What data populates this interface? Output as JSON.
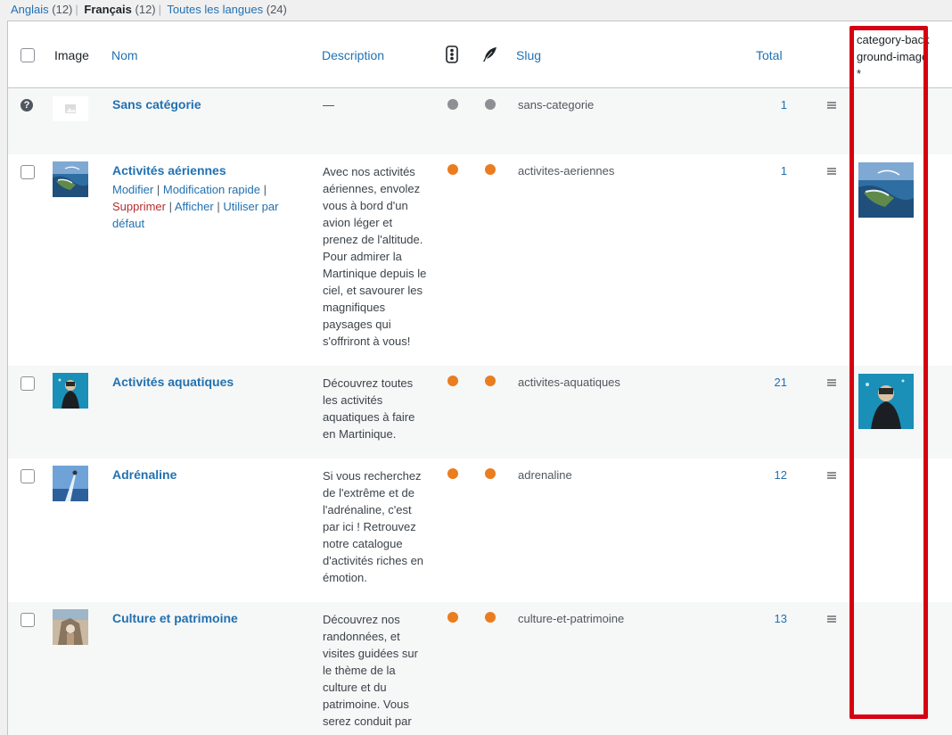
{
  "languages": [
    {
      "label": "Anglais",
      "count": "(12)",
      "current": false
    },
    {
      "label": "Français",
      "count": "(12)",
      "current": true
    },
    {
      "label": "Toutes les langues",
      "count": "(24)",
      "current": false
    }
  ],
  "header": {
    "image": "Image",
    "name": "Nom",
    "description": "Description",
    "slug": "Slug",
    "total": "Total",
    "bg_col": "category-background-image*"
  },
  "icons": {
    "col_translation": "traffic-light-icon",
    "col_quill": "feather-icon",
    "help": "question-icon",
    "handle": "drag-handle-icon"
  },
  "colors": {
    "status_grey": "#8c8f94",
    "status_orange": "#e97d1f",
    "highlight": "#d60012",
    "link": "#2271b1"
  },
  "rows": [
    {
      "name": "Sans catégorie",
      "description": "—",
      "slug": "sans-categorie",
      "total": "1",
      "status": "grey"
    },
    {
      "name": "Activités aériennes",
      "actions": {
        "edit": "Modifier",
        "quick_edit": "Modification rapide",
        "delete": "Supprimer",
        "view": "Afficher",
        "default": "Utiliser par défaut"
      },
      "description": "Avec nos activités aériennes, envolez vous à bord d'un avion léger et prenez de l'altitude. Pour admirer la Martinique depuis le ciel, et savourer les magnifiques paysages qui s'offriront à vous!",
      "slug": "activites-aeriennes",
      "total": "1",
      "status": "orange"
    },
    {
      "name": "Activités aquatiques",
      "description": "Découvrez toutes les activités aquatiques à faire en Martinique.",
      "slug": "activites-aquatiques",
      "total": "21",
      "status": "orange"
    },
    {
      "name": "Adrénaline",
      "description": "Si vous recherchez de l'extrême et de l'adrénaline, c'est par ici ! Retrouvez notre catalogue d'activités riches en émotion.",
      "slug": "adrenaline",
      "total": "12",
      "status": "orange"
    },
    {
      "name": "Culture et patrimoine",
      "description": "Découvrez nos randonnées, et visites guidées sur le thème de la culture et du patrimoine.  Vous serez conduit par",
      "slug": "culture-et-patrimoine",
      "total": "13",
      "status": "orange"
    }
  ]
}
